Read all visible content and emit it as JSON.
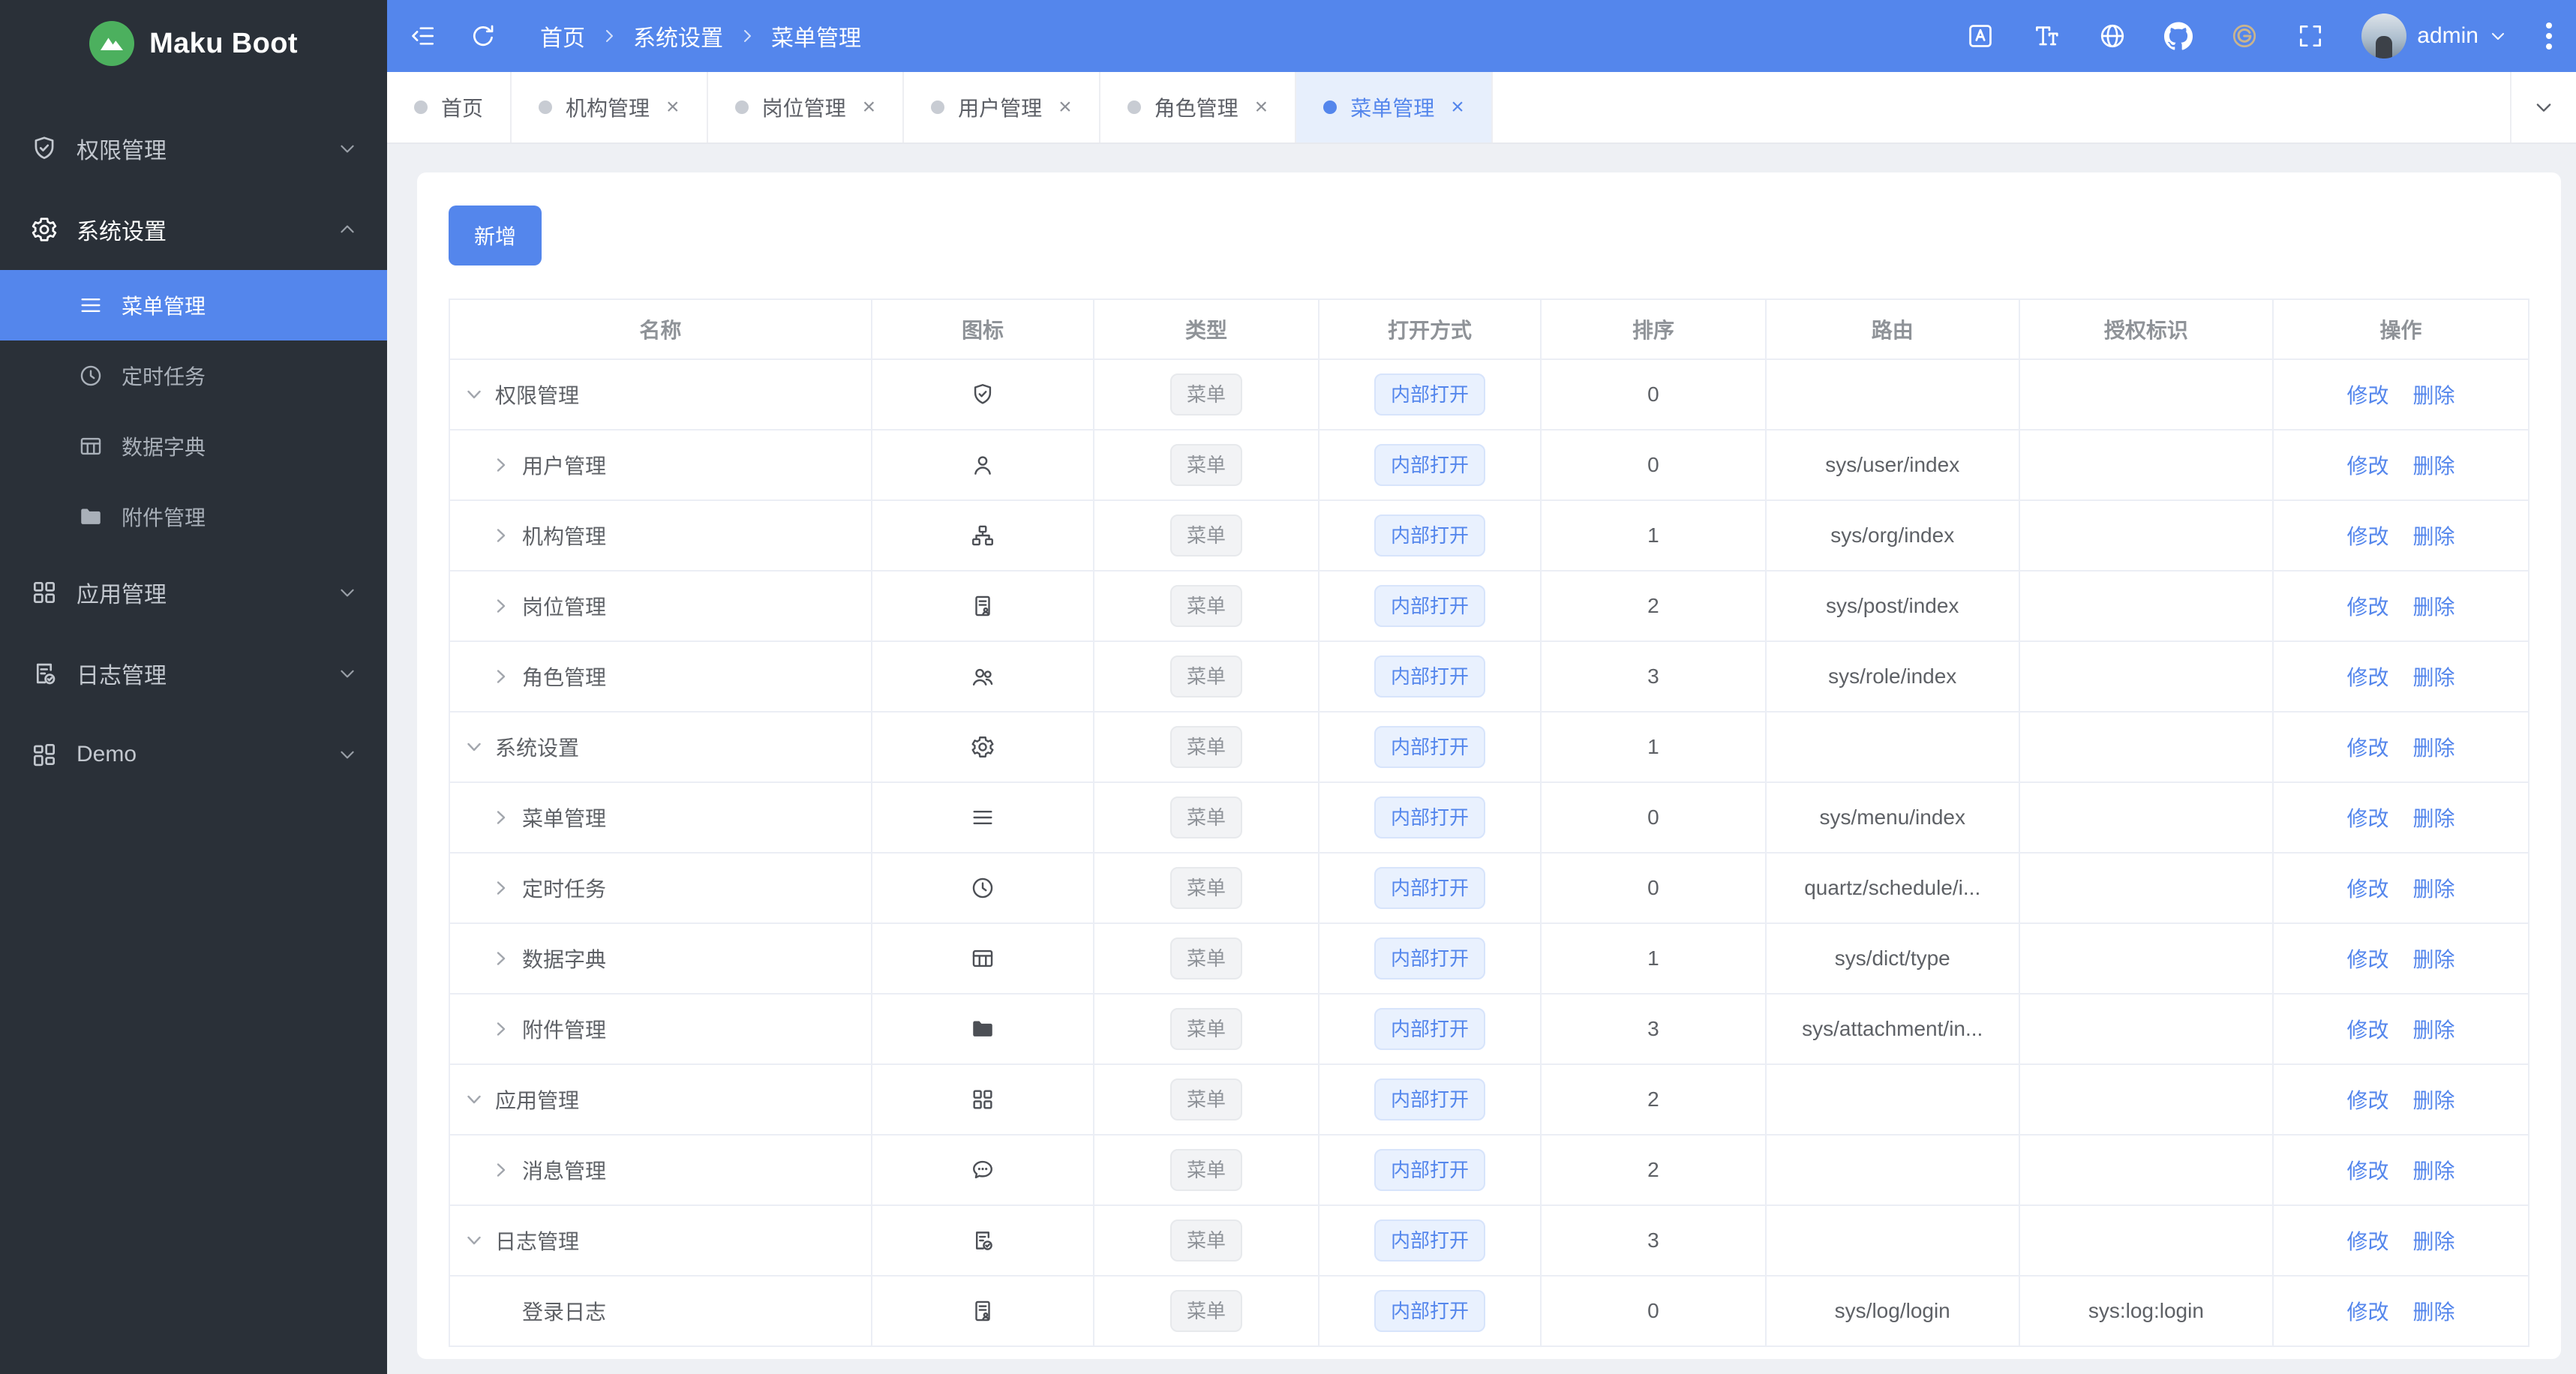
{
  "brand": {
    "name": "Maku Boot",
    "logo_icon": "mountain-icon"
  },
  "colors": {
    "accent": "#5486ec",
    "sidebar_bg": "#2a3038",
    "gitee_gold": "#c9b48e",
    "content_bg": "#eef0f4",
    "active_tab_bg": "#e7effc"
  },
  "header": {
    "breadcrumb": [
      "首页",
      "系统设置",
      "菜单管理"
    ],
    "user": "admin",
    "icons": [
      "collapse-icon",
      "refresh-icon",
      "translate-icon",
      "fontsize-icon",
      "globe-icon",
      "github-icon",
      "gitee-icon",
      "fullscreen-icon",
      "kebab-icon"
    ]
  },
  "sidebar": {
    "items": [
      {
        "label": "权限管理",
        "icon": "shield-check-icon",
        "state": "collapsed"
      },
      {
        "label": "系统设置",
        "icon": "gear-icon",
        "state": "expanded",
        "children": [
          {
            "label": "菜单管理",
            "icon": "menu-lines-icon",
            "active": true
          },
          {
            "label": "定时任务",
            "icon": "clock-icon",
            "active": false
          },
          {
            "label": "数据字典",
            "icon": "dict-table-icon",
            "active": false
          },
          {
            "label": "附件管理",
            "icon": "folder-icon",
            "active": false
          }
        ]
      },
      {
        "label": "应用管理",
        "icon": "app-grid-icon",
        "state": "collapsed"
      },
      {
        "label": "日志管理",
        "icon": "log-doc-icon",
        "state": "collapsed"
      },
      {
        "label": "Demo",
        "icon": "demo-grid-icon",
        "state": "collapsed"
      }
    ]
  },
  "tabs": [
    {
      "label": "首页",
      "closable": false,
      "active": false
    },
    {
      "label": "机构管理",
      "closable": true,
      "active": false
    },
    {
      "label": "岗位管理",
      "closable": true,
      "active": false
    },
    {
      "label": "用户管理",
      "closable": true,
      "active": false
    },
    {
      "label": "角色管理",
      "closable": true,
      "active": false
    },
    {
      "label": "菜单管理",
      "closable": true,
      "active": true
    }
  ],
  "toolbar": {
    "add_label": "新增"
  },
  "table": {
    "columns": [
      "名称",
      "图标",
      "类型",
      "打开方式",
      "排序",
      "路由",
      "授权标识",
      "操作"
    ],
    "actions": {
      "edit": "修改",
      "delete": "删除"
    },
    "rows": [
      {
        "name": "权限管理",
        "level": 0,
        "expand": "down",
        "icon": "shield-check-icon",
        "type": "菜单",
        "open": "内部打开",
        "sort": "0",
        "route": "",
        "auth": ""
      },
      {
        "name": "用户管理",
        "level": 1,
        "expand": "right",
        "icon": "user-icon",
        "type": "菜单",
        "open": "内部打开",
        "sort": "0",
        "route": "sys/user/index",
        "auth": ""
      },
      {
        "name": "机构管理",
        "level": 1,
        "expand": "right",
        "icon": "org-icon",
        "type": "菜单",
        "open": "内部打开",
        "sort": "1",
        "route": "sys/org/index",
        "auth": ""
      },
      {
        "name": "岗位管理",
        "level": 1,
        "expand": "right",
        "icon": "badge-icon",
        "type": "菜单",
        "open": "内部打开",
        "sort": "2",
        "route": "sys/post/index",
        "auth": ""
      },
      {
        "name": "角色管理",
        "level": 1,
        "expand": "right",
        "icon": "role-icon",
        "type": "菜单",
        "open": "内部打开",
        "sort": "3",
        "route": "sys/role/index",
        "auth": ""
      },
      {
        "name": "系统设置",
        "level": 0,
        "expand": "down",
        "icon": "gear-icon",
        "type": "菜单",
        "open": "内部打开",
        "sort": "1",
        "route": "",
        "auth": ""
      },
      {
        "name": "菜单管理",
        "level": 1,
        "expand": "right",
        "icon": "menu-lines-icon",
        "type": "菜单",
        "open": "内部打开",
        "sort": "0",
        "route": "sys/menu/index",
        "auth": ""
      },
      {
        "name": "定时任务",
        "level": 1,
        "expand": "right",
        "icon": "clock-icon",
        "type": "菜单",
        "open": "内部打开",
        "sort": "0",
        "route": "quartz/schedule/i...",
        "auth": ""
      },
      {
        "name": "数据字典",
        "level": 1,
        "expand": "right",
        "icon": "dict-table-icon",
        "type": "菜单",
        "open": "内部打开",
        "sort": "1",
        "route": "sys/dict/type",
        "auth": ""
      },
      {
        "name": "附件管理",
        "level": 1,
        "expand": "right",
        "icon": "folder-icon",
        "type": "菜单",
        "open": "内部打开",
        "sort": "3",
        "route": "sys/attachment/in...",
        "auth": ""
      },
      {
        "name": "应用管理",
        "level": 0,
        "expand": "down",
        "icon": "app-grid-icon",
        "type": "菜单",
        "open": "内部打开",
        "sort": "2",
        "route": "",
        "auth": ""
      },
      {
        "name": "消息管理",
        "level": 1,
        "expand": "right",
        "icon": "message-icon",
        "type": "菜单",
        "open": "内部打开",
        "sort": "2",
        "route": "",
        "auth": ""
      },
      {
        "name": "日志管理",
        "level": 0,
        "expand": "down",
        "icon": "log-doc-icon",
        "type": "菜单",
        "open": "内部打开",
        "sort": "3",
        "route": "",
        "auth": ""
      },
      {
        "name": "登录日志",
        "level": 1,
        "expand": "none",
        "icon": "badge-icon",
        "type": "菜单",
        "open": "内部打开",
        "sort": "0",
        "route": "sys/log/login",
        "auth": "sys:log:login"
      }
    ]
  }
}
